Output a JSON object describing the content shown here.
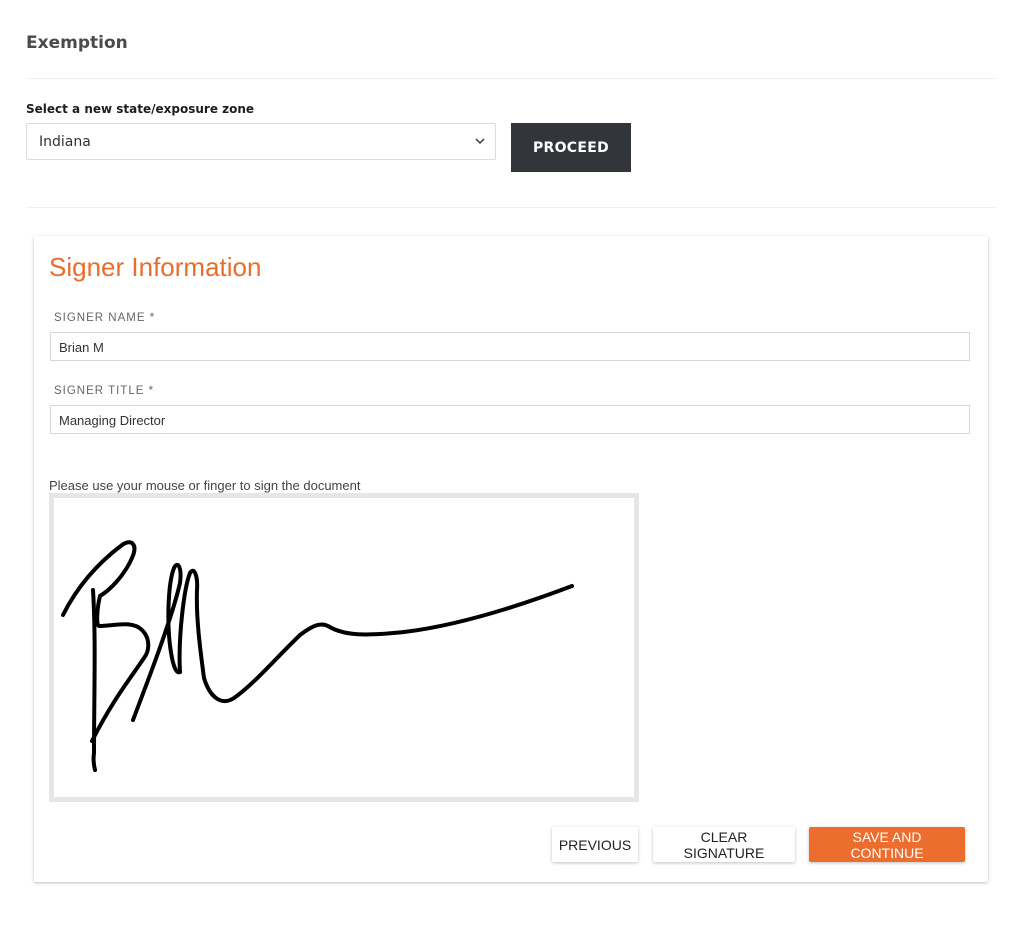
{
  "page": {
    "title": "Exemption"
  },
  "zone": {
    "label": "Select a new state/exposure zone",
    "selected": "Indiana",
    "proceed_label": "PROCEED"
  },
  "signer": {
    "title": "Signer Information",
    "name_label": "SIGNER NAME *",
    "name_value": "Brian M",
    "title_label": "SIGNER TITLE *",
    "title_value": "Managing Director",
    "instructions": "Please use your mouse or finger to sign the document"
  },
  "buttons": {
    "previous": "PREVIOUS",
    "clear_signature": "CLEAR SIGNATURE",
    "save_continue": "SAVE AND CONTINUE"
  },
  "colors": {
    "accent": "#ec6d2e",
    "dark_button": "#32353a"
  },
  "icons": {
    "select_arrow": "chevron-down-icon"
  }
}
